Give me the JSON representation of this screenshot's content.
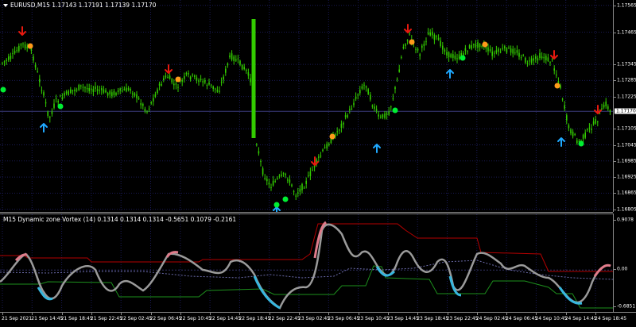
{
  "main_title": "EURUSD,M15  1.17143 1.17191 1.17139 1.17170",
  "indicator_title": "M15 Dynamic zone Vortex (14) 0.1314 0.1314 0.1314 -0.5651 0.1079 -0.2161",
  "price_axis": {
    "labels": [
      "1.17565",
      "1.17465",
      "1.17345",
      "1.17285",
      "1.17225",
      "1.17105",
      "1.17045",
      "1.16985",
      "1.16925",
      "1.16865",
      "1.16805"
    ],
    "values": [
      1.17565,
      1.17465,
      1.17345,
      1.17285,
      1.17225,
      1.17105,
      1.17045,
      1.16985,
      1.16925,
      1.16865,
      1.16805
    ],
    "current": "1.17170",
    "current_value": 1.1717
  },
  "indicator_axis": {
    "labels": [
      "0.9078",
      "0.00",
      "-0.6851"
    ],
    "values": [
      0.9078,
      0.0,
      -0.6851
    ]
  },
  "time_axis": [
    "21 Sep 2021",
    "21 Sep 14:45",
    "21 Sep 18:45",
    "21 Sep 22:45",
    "22 Sep 02:45",
    "22 Sep 06:45",
    "22 Sep 10:45",
    "22 Sep 14:45",
    "22 Sep 18:45",
    "22 Sep 22:45",
    "23 Sep 02:45",
    "23 Sep 06:45",
    "23 Sep 10:45",
    "23 Sep 14:45",
    "23 Sep 18:45",
    "23 Sep 22:45",
    "24 Sep 02:45",
    "24 Sep 06:45",
    "24 Sep 10:45",
    "24 Sep 14:45",
    "24 Sep 18:45"
  ],
  "colors": {
    "background": "#000000",
    "grid": "#1a1a55",
    "candle": "#33cc00",
    "arrow_up": "#1fa9ff",
    "arrow_down": "#e8190f",
    "dot_green": "#00ee33",
    "dot_orange": "#ff9a1a",
    "vortex_line": "#9a9a9a",
    "vortex_high": "#e07b8a",
    "vortex_low": "#37b7de",
    "upper_zone": "#b30000",
    "lower_zone": "#1d8f1d",
    "mid_zone": "#6a6aa8"
  }
}
